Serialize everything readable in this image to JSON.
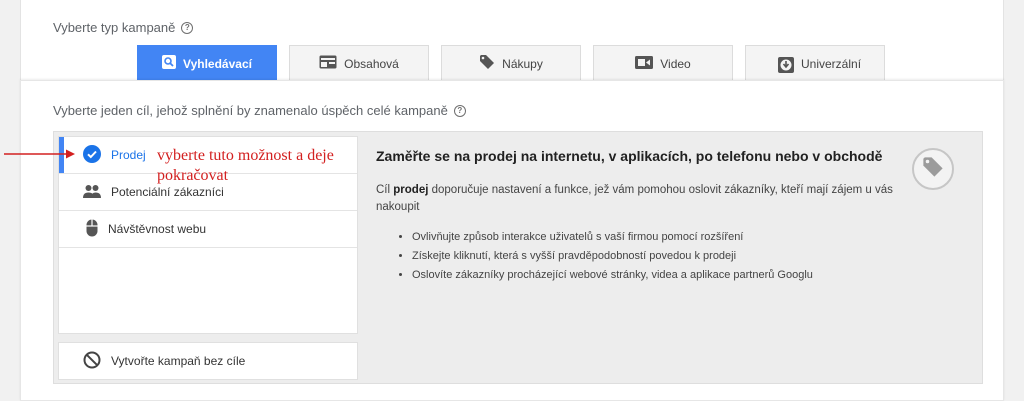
{
  "campaign_type": {
    "label": "Vyberte typ kampaně",
    "tabs": [
      {
        "label": "Vyhledávací",
        "icon": "search-icon",
        "active": true
      },
      {
        "label": "Obsahová",
        "icon": "display-icon",
        "active": false
      },
      {
        "label": "Nákupy",
        "icon": "tag-icon",
        "active": false
      },
      {
        "label": "Video",
        "icon": "video-icon",
        "active": false
      },
      {
        "label": "Univerzální",
        "icon": "download-icon",
        "active": false
      }
    ]
  },
  "goal": {
    "label": "Vyberte jeden cíl, jehož splnění by znamenalo úspěch celé kampaně",
    "items": [
      {
        "label": "Prodej",
        "icon": "check-circle-icon",
        "selected": true
      },
      {
        "label": "Potenciální zákazníci",
        "icon": "people-icon",
        "selected": false
      },
      {
        "label": "Návštěvnost webu",
        "icon": "mouse-icon",
        "selected": false
      }
    ],
    "no_goal_label": "Vytvořte kampaň bez cíle"
  },
  "detail": {
    "heading": "Zaměřte se na prodej na internetu, v aplikacích, po telefonu nebo v obchodě",
    "desc_prefix": "Cíl",
    "desc_bold": "prodej",
    "desc_suffix": "doporučuje nastavení a funkce, jež vám pomohou oslovit zákazníky, kteří mají zájem u vás nakoupit",
    "bullets": [
      "Ovlivňujte způsob interakce uživatelů s vaší firmou pomocí rozšíření",
      "Získejte kliknutí, která s vyšší pravděpodobností povedou k prodeji",
      "Oslovíte zákazníky procházející webové stránky, videa a aplikace partnerů Googlu"
    ],
    "icon": "tag-icon"
  },
  "annotation": {
    "text": "vyberte tuto možnost a deje pokračovat",
    "color": "#d32020"
  },
  "colors": {
    "accent": "#4285f4"
  }
}
